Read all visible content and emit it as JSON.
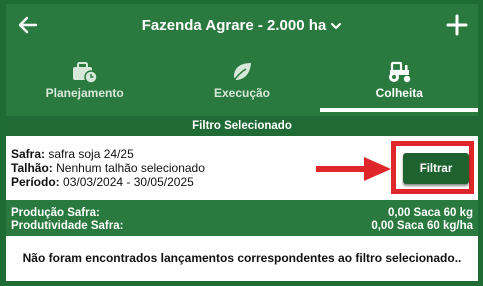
{
  "header": {
    "title": "Fazenda Agrare - 2.000 ha",
    "back_icon": "arrow-left-icon",
    "dropdown_icon": "chevron-down-icon",
    "add_icon": "plus-icon"
  },
  "tabs": [
    {
      "label": "Planejamento",
      "icon": "briefcase-clock-icon",
      "active": false
    },
    {
      "label": "Execução",
      "icon": "leaf-icon",
      "active": false
    },
    {
      "label": "Colheita",
      "icon": "tractor-icon",
      "active": true
    }
  ],
  "filter_strip": {
    "label": "Filtro Selecionado"
  },
  "filter": {
    "safra_label": "Safra:",
    "safra_value": "safra soja 24/25",
    "talhao_label": "Talhão:",
    "talhao_value": "Nenhum talhão selecionado",
    "periodo_label": "Período:",
    "periodo_value": "03/03/2024 - 30/05/2025",
    "button_label": "Filtrar"
  },
  "totals": {
    "producao_label": "Produção Safra:",
    "producao_value": "0,00 Saca 60 kg",
    "produtividade_label": "Produtividade Safra:",
    "produtividade_value": "0,00 Saca 60 kg/ha"
  },
  "empty_message": "Não foram encontrados lançamentos correspondentes ao filtro selecionado..",
  "colors": {
    "primary_green": "#2a7a3f",
    "dark_green": "#1e6230",
    "annotation_red": "#e0262a"
  }
}
